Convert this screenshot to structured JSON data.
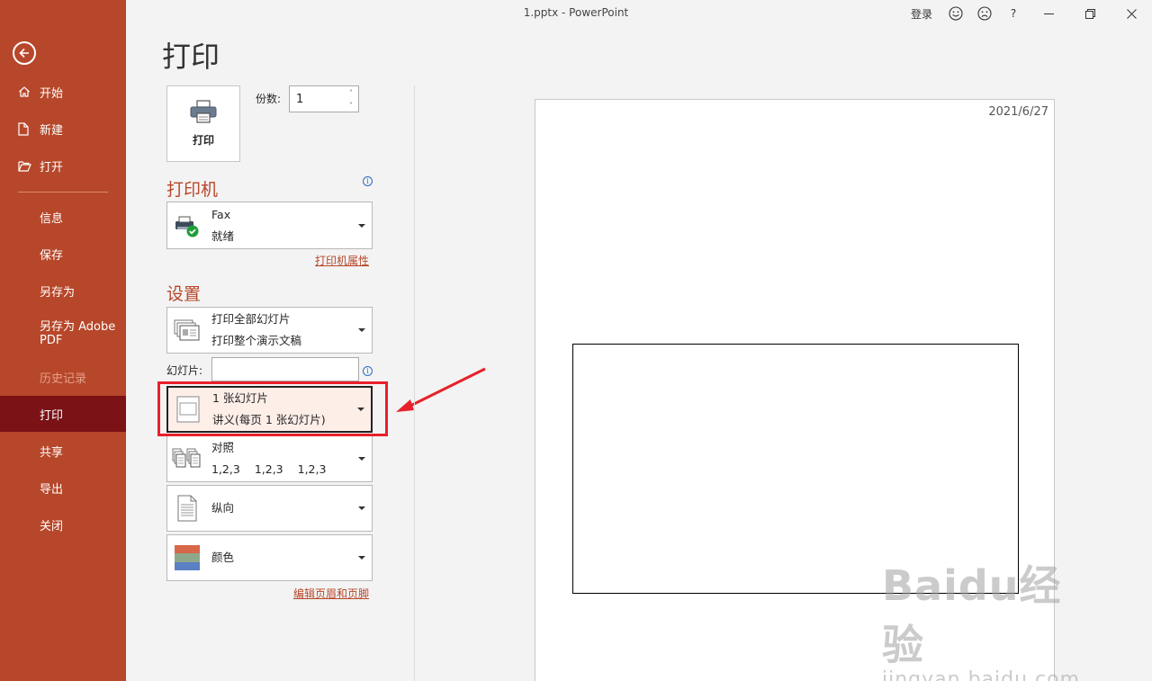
{
  "window": {
    "title": "1.pptx  -  PowerPoint",
    "login": "登录",
    "help": "?"
  },
  "sidebar": {
    "items": [
      {
        "label": "开始",
        "icon": "home-icon"
      },
      {
        "label": "新建",
        "icon": "new-file-icon"
      },
      {
        "label": "打开",
        "icon": "folder-open-icon"
      },
      {
        "label": "信息"
      },
      {
        "label": "保存"
      },
      {
        "label": "另存为"
      },
      {
        "label": "另存为 Adobe PDF"
      },
      {
        "label": "历史记录"
      },
      {
        "label": "打印"
      },
      {
        "label": "共享"
      },
      {
        "label": "导出"
      },
      {
        "label": "关闭"
      }
    ]
  },
  "print": {
    "title": "打印",
    "print_button": "打印",
    "copies_label": "份数:",
    "copies_value": "1"
  },
  "printer": {
    "heading": "打印机",
    "name": "Fax",
    "status": "就绪",
    "properties_link": "打印机属性"
  },
  "settings": {
    "heading": "设置",
    "range_title": "打印全部幻灯片",
    "range_sub": "打印整个演示文稿",
    "slides_label": "幻灯片:",
    "slides_value": "",
    "layout_title": "1 张幻灯片",
    "layout_sub": "讲义(每页 1 张幻灯片)",
    "collate_title": "对照",
    "collate_values": [
      "1,2,3",
      "1,2,3",
      "1,2,3"
    ],
    "orientation": "纵向",
    "color": "颜色",
    "header_footer_link": "编辑页眉和页脚"
  },
  "preview": {
    "date": "2021/6/27"
  },
  "watermark": {
    "top": "Baidu经验",
    "bottom": "jingyan.baidu.com"
  },
  "colors": {
    "accent": "#b7472a",
    "active_nav": "#7a1216",
    "highlight_box": "#e8202a"
  }
}
